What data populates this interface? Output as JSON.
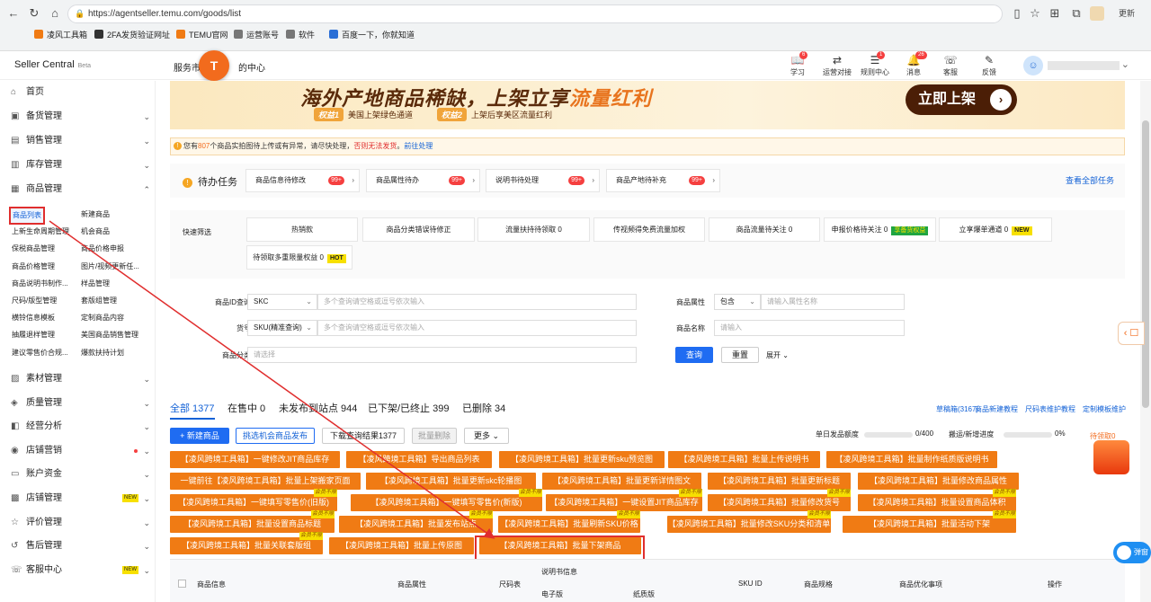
{
  "browser": {
    "url": "https://agentseller.temu.com/goods/list",
    "update_label": "更新",
    "bookmarks": [
      "凌风工具箱",
      "2FA发货验证网址",
      "TEMU官网",
      "运营账号",
      "软件",
      "百度一下，你就知道"
    ]
  },
  "header": {
    "brand": "Seller Central",
    "beta": "Beta",
    "service": "服务市",
    "service_tail": "的中心",
    "fab_letter": "T",
    "icons": [
      {
        "label": "学习",
        "badge": "6"
      },
      {
        "label": "运营对接",
        "badge": ""
      },
      {
        "label": "规则中心",
        "badge": "1"
      },
      {
        "label": "消息",
        "badge": "26"
      },
      {
        "label": "客服",
        "badge": ""
      },
      {
        "label": "反馈",
        "badge": ""
      }
    ]
  },
  "sidebar": {
    "menus": [
      {
        "label": "首页",
        "icon": "home-icon",
        "arrow": ""
      },
      {
        "label": "备货管理",
        "icon": "box-icon",
        "arrow": "⌄"
      },
      {
        "label": "销售管理",
        "icon": "chart-icon",
        "arrow": "⌄"
      },
      {
        "label": "库存管理",
        "icon": "warehouse-icon",
        "arrow": "⌄"
      },
      {
        "label": "商品管理",
        "icon": "goods-icon",
        "arrow": "⌃"
      }
    ],
    "sub_left": [
      "商品列表",
      "上新生命周期管理",
      "保税商品管理",
      "商品价格管理",
      "商品说明书制作...",
      "尺码/版型管理",
      "横铃信息模板",
      "抽履退样管理",
      "建议零售价合规..."
    ],
    "sub_right": [
      "新建商品",
      "机会商品",
      "商品价格申报",
      "图片/视频更新任...",
      "样品管理",
      "套版组管理",
      "定制商品内容",
      "美国商品销售管理",
      "爆款扶持计划"
    ],
    "menus2": [
      {
        "label": "素材管理",
        "icon": "image-icon",
        "tag": "",
        "dot": false
      },
      {
        "label": "质量管理",
        "icon": "quality-icon",
        "tag": "",
        "dot": false
      },
      {
        "label": "经营分析",
        "icon": "analysis-icon",
        "tag": "",
        "dot": false
      },
      {
        "label": "店铺营销",
        "icon": "marketing-icon",
        "tag": "",
        "dot": true
      },
      {
        "label": "账户资金",
        "icon": "wallet-icon",
        "tag": "",
        "dot": false
      },
      {
        "label": "店铺管理",
        "icon": "store-icon",
        "tag": "NEW",
        "dot": false
      },
      {
        "label": "评价管理",
        "icon": "review-icon",
        "tag": "",
        "dot": false
      },
      {
        "label": "售后管理",
        "icon": "aftersale-icon",
        "tag": "",
        "dot": false
      },
      {
        "label": "客服中心",
        "icon": "support-icon",
        "tag": "NEW",
        "dot": false
      }
    ]
  },
  "banner": {
    "title_a": "海外产地商品稀缺，上架立享",
    "title_b": "流量红利",
    "b1_tag": "权益1",
    "b1_text": "美国上架绿色通道",
    "b2_tag": "权益2",
    "b2_text": "上架后享美区流量红利",
    "cta": "立即上架"
  },
  "notice": {
    "pre": "您有",
    "count": "807",
    "mid": "个商品实拍图待上传或有异常，请尽快处理，",
    "warn": "否则无法发货",
    "sep": "。",
    "link": "前往处理"
  },
  "todo": {
    "label": "待办任务",
    "all_link": "查看全部任务",
    "cards": [
      {
        "label": "商品信息待修改",
        "count": "99+"
      },
      {
        "label": "商品属性待办",
        "count": "99+"
      },
      {
        "label": "说明书待处理",
        "count": "99+"
      },
      {
        "label": "商品产地待补充",
        "count": "99+"
      }
    ]
  },
  "quick": {
    "label": "快速筛选",
    "chips": [
      {
        "text": "热销款",
        "tag": "",
        "tag_type": ""
      },
      {
        "text": "商品分类错误待修正",
        "tag": "",
        "tag_type": ""
      },
      {
        "text": "流量扶持待领取  0",
        "tag": "",
        "tag_type": ""
      },
      {
        "text": "传视频得免费流量加权",
        "tag": "",
        "tag_type": ""
      },
      {
        "text": "商品流量待关注  0",
        "tag": "",
        "tag_type": ""
      },
      {
        "text": "申报价格待关注  0",
        "tag": "享备货权益",
        "tag_type": "green"
      },
      {
        "text": "立享爆单通道  0",
        "tag": "NEW",
        "tag_type": "yellow"
      },
      {
        "text": "待领取多重限量权益  0",
        "tag": "HOT",
        "tag_type": "yellow"
      }
    ]
  },
  "search": {
    "id_label": "商品ID查询",
    "id_type": "SKC",
    "id_placeholder": "多个查询请空格或逗号依次输入",
    "sku_label": "货号",
    "sku_type": "SKU(精准查询)",
    "sku_placeholder": "多个查询请空格或逗号依次输入",
    "cat_label": "商品分类",
    "cat_placeholder": "请选择",
    "attr_label": "商品属性",
    "attr_type": "包含",
    "attr_placeholder": "请输入属性名称",
    "name_label": "商品名称",
    "name_placeholder": "请输入",
    "query_btn": "查询",
    "reset_btn": "重置",
    "expand": "展开 ⌄"
  },
  "tabs": {
    "items": [
      "全部 1377",
      "在售中 0",
      "未发布到站点 944",
      "已下架/已终止 399",
      "已删除 34"
    ],
    "links": [
      "草稿箱(3167)",
      "商品新建教程",
      "尺码表维护教程",
      "定制模板维护"
    ]
  },
  "toolbar": {
    "new_goods": "+ 新建商品",
    "pick": "挑选机会商品发布",
    "download": "下载查询结果1377",
    "batch_delete": "批量删除",
    "more": "更多 ⌄",
    "quota_label": "单日发品额度",
    "quota_val": "0/400",
    "progress_label": "搬运/新增进度",
    "progress_val": "0%"
  },
  "tools": {
    "vip_tag": "会员不限",
    "buttons": [
      "【凌风跨境工具箱】一键修改JIT商品库存",
      "【凌风跨境工具箱】导出商品列表",
      "【凌风跨境工具箱】批量更新sku预览图",
      "【凌风跨境工具箱】批量上传说明书",
      "【凌风跨境工具箱】批量制作纸质版说明书",
      "一键前往【凌风跨境工具箱】批量上架搬家页面",
      "【凌风跨境工具箱】批量更新skc轮播图",
      "【凌风跨境工具箱】批量更新详情图文",
      "【凌风跨境工具箱】批量更新标题",
      "【凌风跨境工具箱】批量修改商品属性",
      "【凌风跨境工具箱】一键填写零售价(旧版)",
      "【凌风跨境工具箱】一键填写零售价(新版)",
      "【凌风跨境工具箱】一键设置JIT商品库存",
      "【凌风跨境工具箱】批量修改货号",
      "【凌风跨境工具箱】批量设置商品体积",
      "【凌风跨境工具箱】批量设置商品标题",
      "【凌风跨境工具箱】批量发布站点",
      "【凌风跨境工具箱】批量刷新SKU价格",
      "【凌风跨境工具箱】批量修改SKU分类和清单",
      "【凌风跨境工具箱】批量活动下架",
      "【凌风跨境工具箱】批量关联套版组",
      "【凌风跨境工具箱】批量上传原图",
      "【凌风跨境工具箱】批量下架商品"
    ]
  },
  "table": {
    "cols": [
      "商品信息",
      "商品属性",
      "尺码表",
      "说明书信息",
      "SKU ID",
      "商品规格",
      "商品优化事项",
      "操作"
    ],
    "sub_cols": [
      "电子版",
      "纸质版"
    ]
  },
  "floats": {
    "gift_text": "待领取0",
    "toggle_text": "弹窗"
  },
  "colors": {
    "accent": "#f07b14",
    "primary": "#1f6cf2",
    "highlight": "#e02e2e"
  }
}
